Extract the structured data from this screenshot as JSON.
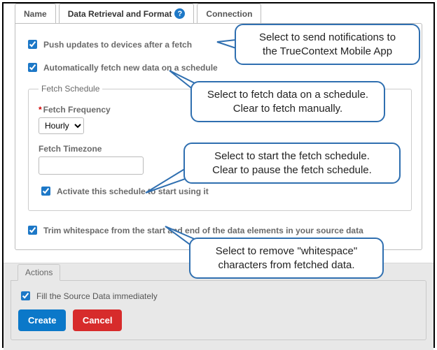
{
  "tabs": {
    "name": "Name",
    "data": "Data Retrieval and Format",
    "connection": "Connection"
  },
  "checkboxes": {
    "push_updates": "Push updates to devices after a fetch",
    "auto_fetch": "Automatically fetch new data on a schedule",
    "activate_schedule": "Activate this schedule to start using it",
    "trim_whitespace": "Trim whitespace from the start and end of the data elements in your source data",
    "fill_immediately": "Fill the Source Data immediately"
  },
  "schedule": {
    "legend": "Fetch Schedule",
    "frequency_label": "Fetch Frequency",
    "frequency_value": "Hourly",
    "timezone_label": "Fetch Timezone",
    "timezone_value": ""
  },
  "actions": {
    "legend": "Actions",
    "create": "Create",
    "cancel": "Cancel"
  },
  "callouts": {
    "c1a": "Select to send notifications to",
    "c1b": "the TrueContext Mobile App",
    "c2a": "Select to fetch data on a schedule.",
    "c2b": "Clear to fetch manually.",
    "c3a": "Select to start the fetch schedule.",
    "c3b": "Clear to pause the fetch schedule.",
    "c4a": "Select to remove \"whitespace\"",
    "c4b": "characters from fetched data."
  }
}
